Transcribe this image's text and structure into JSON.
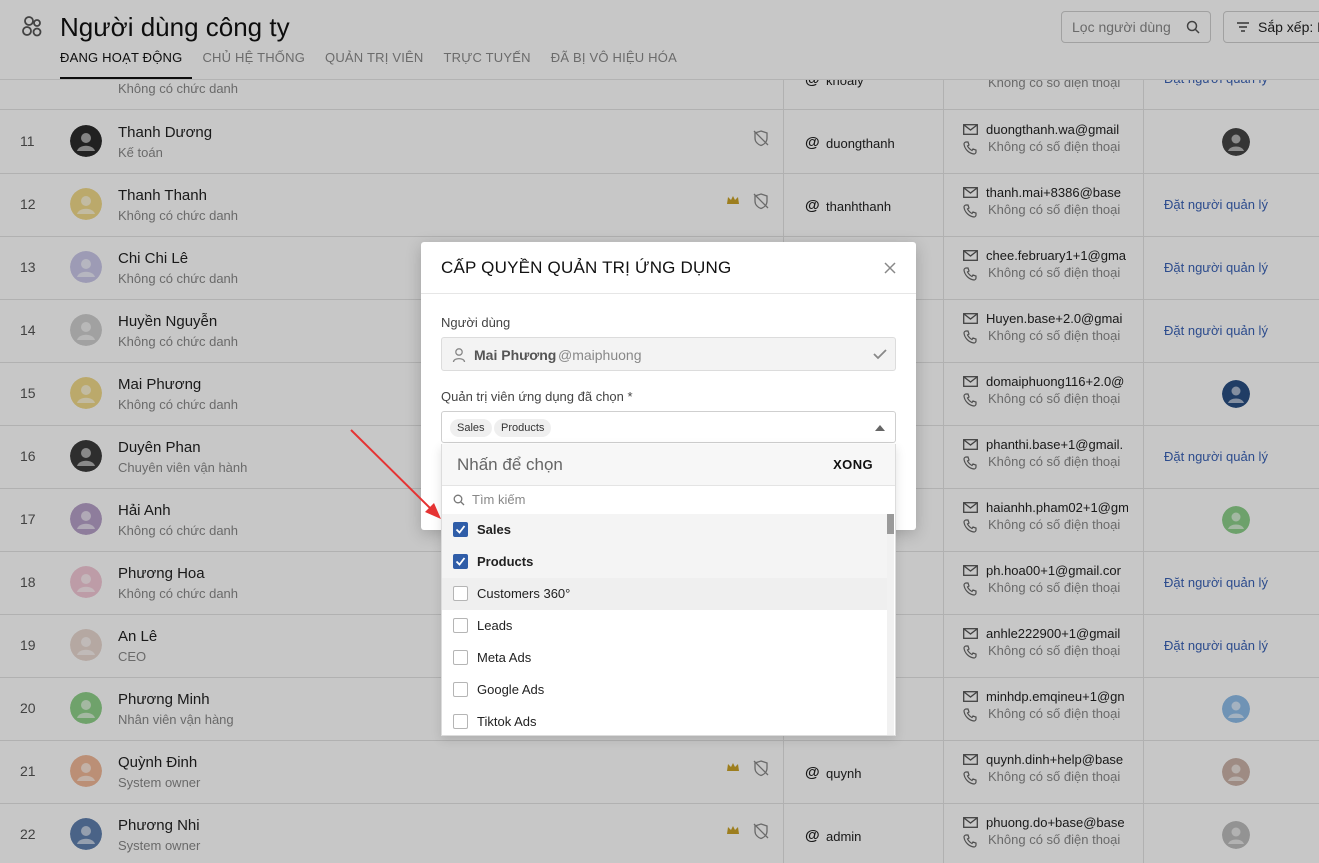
{
  "header": {
    "title": "Người dùng công ty",
    "tabs": [
      "ĐANG HOẠT ĐỘNG",
      "CHỦ HỆ THỐNG",
      "QUẢN TRỊ VIÊN",
      "TRỰC TUYẾN",
      "ĐÃ BỊ VÔ HIỆU HÓA"
    ],
    "active_tab": "ĐANG HOẠT ĐỘNG",
    "filter_placeholder": "Lọc người dùng",
    "sort_label": "Sắp xếp: N"
  },
  "table": {
    "top_row": {
      "title": "Không có chức danh",
      "handle": "khoaly",
      "phone": "Không có số điện thoại",
      "manager": "Đặt người quản lý"
    },
    "rows": [
      {
        "num": "11",
        "name": "Thanh Dương",
        "title": "Kế toán",
        "handle": "duongthanh",
        "email": "duongthanh.wa@gmail",
        "phone": "Không có số điện thoại",
        "manager": "",
        "crown": false,
        "shield": true
      },
      {
        "num": "12",
        "name": "Thanh Thanh",
        "title": "Không có chức danh",
        "handle": "thanhthanh",
        "email": "thanh.mai+8386@base",
        "phone": "Không có số điện thoại",
        "manager": "Đặt người quản lý",
        "crown": true,
        "shield": true
      },
      {
        "num": "13",
        "name": "Chi Chi Lê",
        "title": "Không có chức danh",
        "handle": "",
        "email": "chee.february1+1@gma",
        "phone": "Không có số điện thoại",
        "manager": "Đặt người quản lý",
        "crown": false,
        "shield": false
      },
      {
        "num": "14",
        "name": "Huyền Nguyễn",
        "title": "Không có chức danh",
        "handle": "",
        "email": "Huyen.base+2.0@gmai",
        "phone": "Không có số điện thoại",
        "manager": "Đặt người quản lý",
        "crown": false,
        "shield": false
      },
      {
        "num": "15",
        "name": "Mai Phương",
        "title": "Không có chức danh",
        "handle": "",
        "email": "domaiphuong116+2.0@",
        "phone": "Không có số điện thoại",
        "manager": "",
        "crown": false,
        "shield": false
      },
      {
        "num": "16",
        "name": "Duyên Phan",
        "title": "Chuyên viên vận hành",
        "handle": "",
        "email": "phanthi.base+1@gmail.",
        "phone": "Không có số điện thoại",
        "manager": "Đặt người quản lý",
        "crown": false,
        "shield": false
      },
      {
        "num": "17",
        "name": "Hải Anh",
        "title": "Không có chức danh",
        "handle": "",
        "email": "haianhh.pham02+1@gm",
        "phone": "Không có số điện thoại",
        "manager": "",
        "crown": false,
        "shield": false
      },
      {
        "num": "18",
        "name": "Phương Hoa",
        "title": "Không có chức danh",
        "handle": "",
        "email": "ph.hoa00+1@gmail.cor",
        "phone": "Không có số điện thoại",
        "manager": "Đặt người quản lý",
        "crown": false,
        "shield": false
      },
      {
        "num": "19",
        "name": "An Lê",
        "title": "CEO",
        "handle": "",
        "email": "anhle222900+1@gmail",
        "phone": "Không có số điện thoại",
        "manager": "Đặt người quản lý",
        "crown": false,
        "shield": false
      },
      {
        "num": "20",
        "name": "Phương Minh",
        "title": "Nhân viên vận hàng",
        "handle": "",
        "email": "minhdp.emqineu+1@gn",
        "phone": "Không có số điện thoại",
        "manager": "",
        "crown": false,
        "shield": false
      },
      {
        "num": "21",
        "name": "Quỳnh Đinh",
        "title": "System owner",
        "handle": "quynh",
        "email": "quynh.dinh+help@base",
        "phone": "Không có số điện thoại",
        "manager": "",
        "crown": true,
        "shield": true
      },
      {
        "num": "22",
        "name": "Phương Nhi",
        "title": "System owner",
        "handle": "admin",
        "email": "phuong.do+base@base",
        "phone": "Không có số điện thoại",
        "manager": "",
        "crown": true,
        "shield": true
      }
    ]
  },
  "modal": {
    "title": "CẤP QUYỀN QUẢN TRỊ ỨNG DỤNG",
    "user_label": "Người dùng",
    "user_name": "Mai Phương",
    "user_handle": "@maiphuong",
    "apps_label": "Quản trị viên ứng dụng đã chọn *",
    "chips": [
      "Sales",
      "Products"
    ]
  },
  "dropdown": {
    "placeholder": "Nhấn để chọn",
    "done_label": "XONG",
    "search_placeholder": "Tìm kiếm",
    "options": [
      {
        "label": "Sales",
        "checked": true
      },
      {
        "label": "Products",
        "checked": true
      },
      {
        "label": "Customers 360°",
        "checked": false
      },
      {
        "label": "Leads",
        "checked": false
      },
      {
        "label": "Meta Ads",
        "checked": false
      },
      {
        "label": "Google Ads",
        "checked": false
      },
      {
        "label": "Tiktok Ads",
        "checked": false
      }
    ]
  },
  "colors": {
    "accent": "#2f5da8",
    "link": "#3a62b5",
    "annotation_arrow": "#e53333",
    "crown": "#c9a227"
  }
}
